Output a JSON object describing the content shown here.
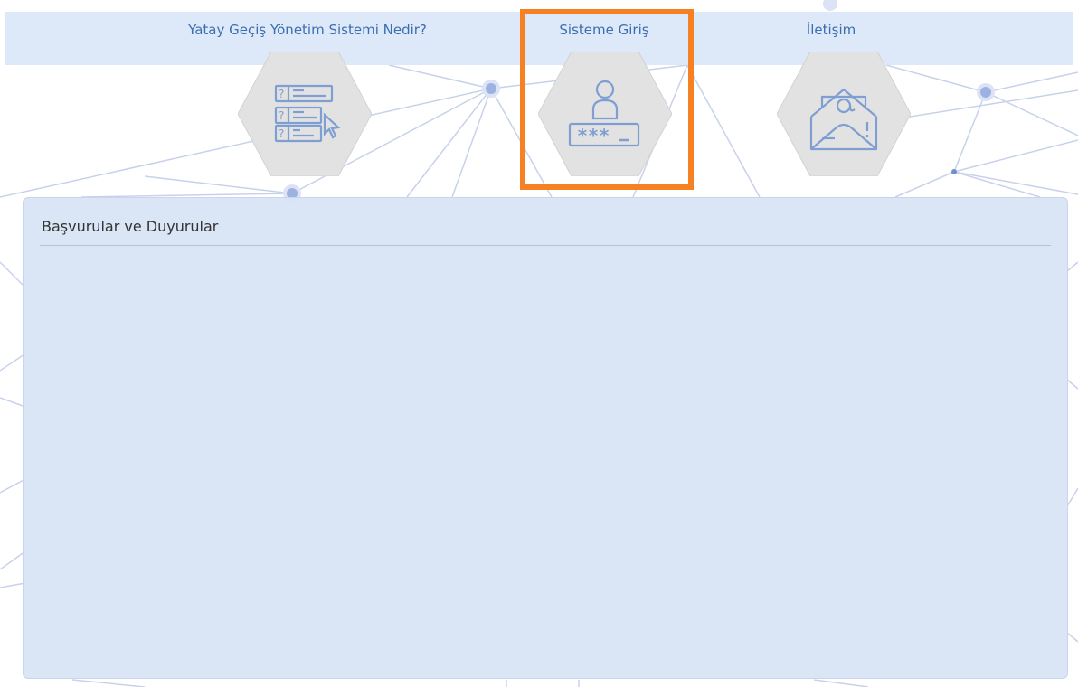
{
  "nav": {
    "about_label": "Yatay Geçiş Yönetim Sistemi Nedir?",
    "login_label": "Sisteme Giriş",
    "contact_label": "İletişim"
  },
  "icons": {
    "about": "faq-list-icon",
    "login": "user-login-icon",
    "contact": "email-icon"
  },
  "announcements": {
    "title": "Başvurular ve Duyurular"
  },
  "colors": {
    "link": "#3b6eb0",
    "highlight": "#f58122",
    "panel": "#d9e5f6",
    "hex_fill": "#e2e2e2",
    "icon_stroke": "#7f9ed1"
  }
}
